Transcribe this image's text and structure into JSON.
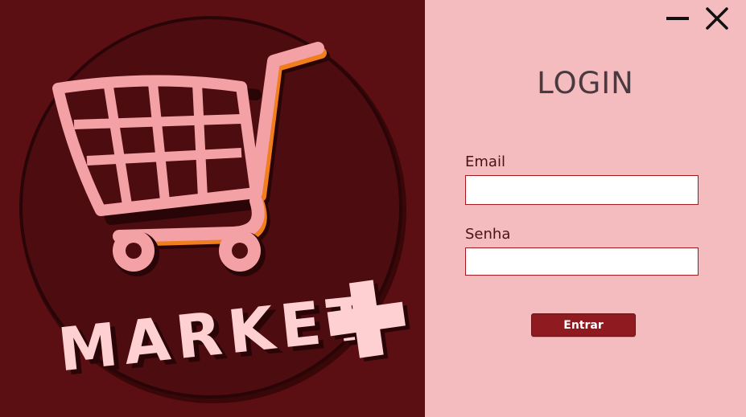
{
  "logo": {
    "text": "MARKET",
    "plus_icon": "plus-icon",
    "cart_icon": "shopping-cart-icon",
    "colors": {
      "background": "#5c0f13",
      "circle": "#4d0c10",
      "cart_fill": "#f4a1a6",
      "cart_accent": "#f07d1e",
      "text_fill": "#ffd0d2"
    }
  },
  "window_controls": {
    "minimize_icon": "minimize-icon",
    "close_icon": "close-icon"
  },
  "login": {
    "title": "LOGIN",
    "email_label": "Email",
    "email_value": "",
    "password_label": "Senha",
    "password_value": "",
    "submit_label": "Entrar",
    "colors": {
      "panel_bg": "#f4bcbe",
      "button_bg": "#8f1a1f",
      "input_border": "#a01a20"
    }
  }
}
